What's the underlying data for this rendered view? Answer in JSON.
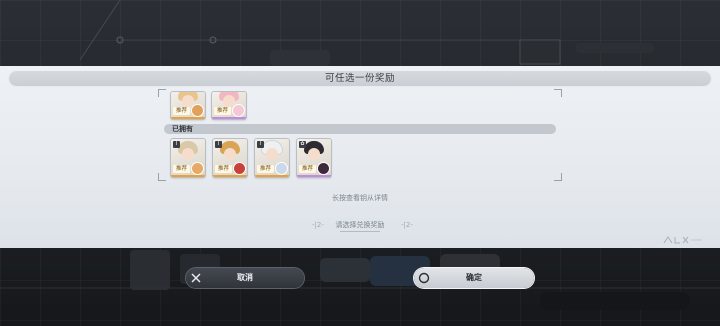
{
  "dialog": {
    "title": "可任选一份奖励",
    "owned_label": "已拥有",
    "hint": "长按查看钥从详情",
    "select_hint": "请选择兑换奖励",
    "deco_left": "-|2-",
    "deco_right": "-|2-"
  },
  "top_cards": [
    {
      "tag": "推荐",
      "hair": "#e9c48f",
      "avatar": "#e0a15a",
      "stripe": "#e9a23b"
    },
    {
      "tag": "推荐",
      "hair": "#f2b7c2",
      "avatar": "#f4c9d5",
      "stripe": "#c28be0"
    }
  ],
  "owned_cards": [
    {
      "tag": "推荐",
      "hair": "#d9c9a6",
      "avatar": "#e6a968",
      "stripe": "#e9a23b",
      "cls": "I"
    },
    {
      "tag": "推荐",
      "hair": "#d9a455",
      "avatar": "#c8423c",
      "stripe": "#e9a23b",
      "cls": "I"
    },
    {
      "tag": "推荐",
      "hair": "#eef0f2",
      "avatar": "#c9d8ea",
      "stripe": "#e9a23b",
      "cls": "I"
    },
    {
      "tag": "推荐",
      "hair": "#2d2b31",
      "avatar": "#3c2a3a",
      "stripe": "#c28be0",
      "cls": "✿"
    }
  ],
  "buttons": {
    "cancel_label": "取消",
    "confirm_label": "确定"
  },
  "colors": {
    "accent_gold": "#e9a23b",
    "accent_purple": "#c28be0"
  }
}
